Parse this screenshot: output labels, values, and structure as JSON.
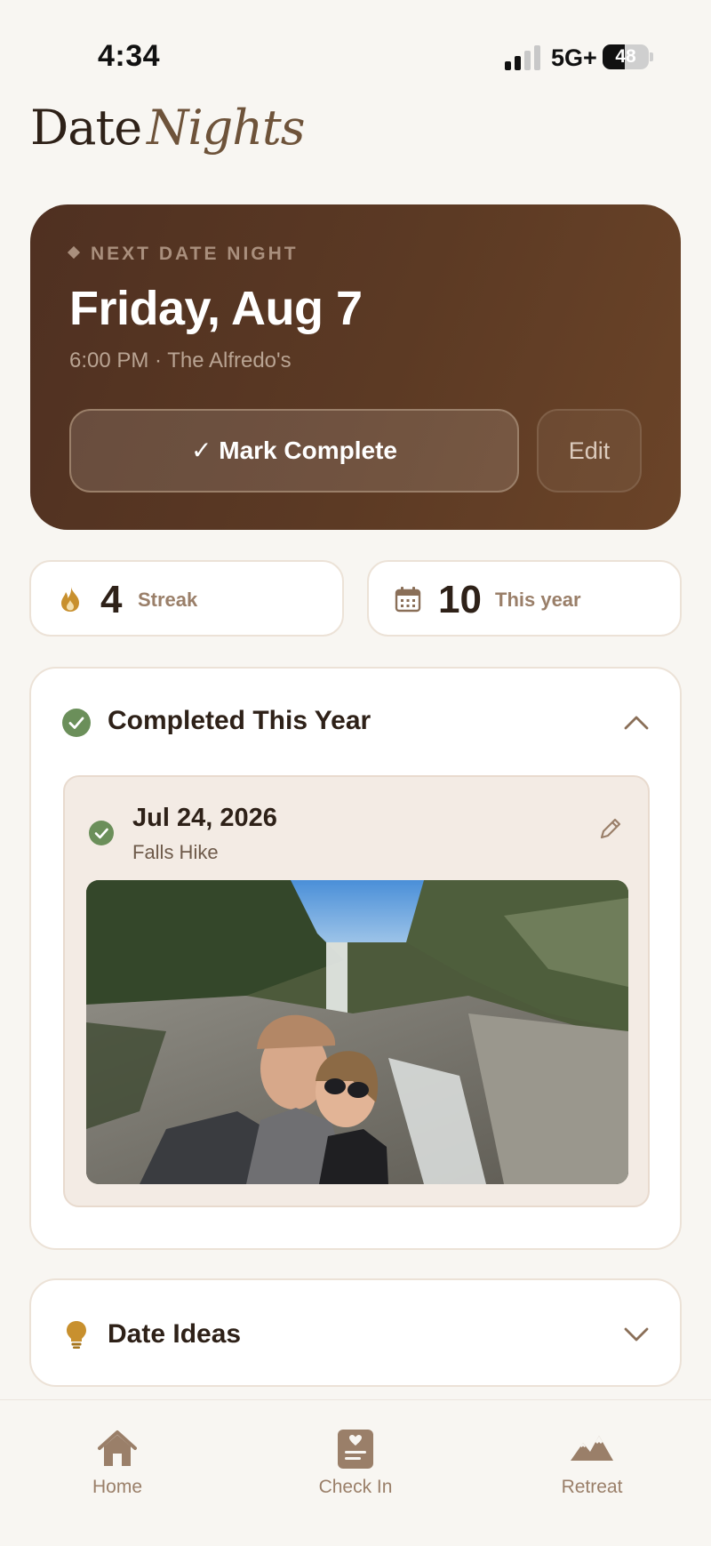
{
  "status_bar": {
    "time": "4:34",
    "network": "5G+",
    "battery": "48"
  },
  "title": {
    "main": "Date",
    "accent": "Nights"
  },
  "next_date": {
    "eyebrow": "NEXT DATE NIGHT",
    "date": "Friday, Aug 7",
    "details": "6:00 PM · The Alfredo's",
    "mark_complete_label": "✓ Mark Complete",
    "edit_label": "Edit"
  },
  "stats": {
    "streak": {
      "value": "4",
      "label": "Streak",
      "icon": "flame-icon"
    },
    "year": {
      "value": "10",
      "label": "This year",
      "icon": "calendar-icon"
    }
  },
  "completed": {
    "title": "Completed This Year",
    "expanded": true,
    "entries": [
      {
        "date": "Jul 24, 2026",
        "name": "Falls Hike"
      }
    ]
  },
  "date_ideas": {
    "title": "Date Ideas",
    "expanded": false
  },
  "tabs": [
    {
      "label": "Home",
      "icon": "home-icon"
    },
    {
      "label": "Check In",
      "icon": "check-in-icon"
    },
    {
      "label": "Retreat",
      "icon": "mountains-icon"
    }
  ],
  "colors": {
    "background": "#f8f6f2",
    "card_dark": "#5c3a24",
    "accent_brown": "#9a7f69",
    "success_green": "#6b8f5a",
    "icon_gold": "#c8902e"
  }
}
